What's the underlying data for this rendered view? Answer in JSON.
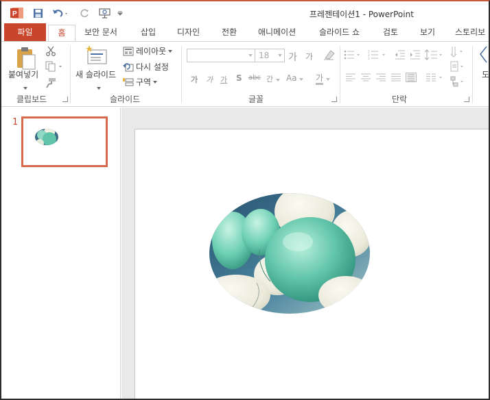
{
  "window": {
    "title": "프레젠테이션1 - PowerPoint"
  },
  "quick_access": {
    "icons": [
      "powerpoint-logo-icon",
      "save-icon",
      "undo-icon",
      "redo-icon",
      "slideshow-icon",
      "customize-icon"
    ]
  },
  "tabs": [
    {
      "label": "파일",
      "active": false
    },
    {
      "label": "홈",
      "active": true
    },
    {
      "label": "보안 문서",
      "active": false
    },
    {
      "label": "삽입",
      "active": false
    },
    {
      "label": "디자인",
      "active": false
    },
    {
      "label": "전환",
      "active": false
    },
    {
      "label": "애니메이션",
      "active": false
    },
    {
      "label": "슬라이드 쇼",
      "active": false
    },
    {
      "label": "검토",
      "active": false
    },
    {
      "label": "보기",
      "active": false
    },
    {
      "label": "스토리보",
      "active": false
    }
  ],
  "ribbon": {
    "clipboard": {
      "group_label": "클립보드",
      "paste_label": "붙여넣기"
    },
    "slides": {
      "group_label": "슬라이드",
      "new_slide_label": "새 슬라이드",
      "layout_label": "레이아웃",
      "reset_label": "다시 설정",
      "section_label": "구역"
    },
    "font": {
      "group_label": "글꼴",
      "font_name": "",
      "font_size": "18",
      "grow_label": "가",
      "shrink_label": "가",
      "bold_label": "가",
      "italic_label": "가",
      "underline_label": "가",
      "shadow_label": "S",
      "strike_label": "abc",
      "spacing_label": "간",
      "case_label": "Aa",
      "color_label": "가"
    },
    "paragraph": {
      "group_label": "단락"
    },
    "drawing": {
      "partial_label": "도"
    }
  },
  "slides_pane": {
    "slides": [
      {
        "number": "1"
      }
    ]
  },
  "colors": {
    "accent": "#c9462c",
    "thumb_border": "#d56a4c",
    "balloon_teal": "#5fc4a8",
    "sky": "#3a6a86"
  }
}
